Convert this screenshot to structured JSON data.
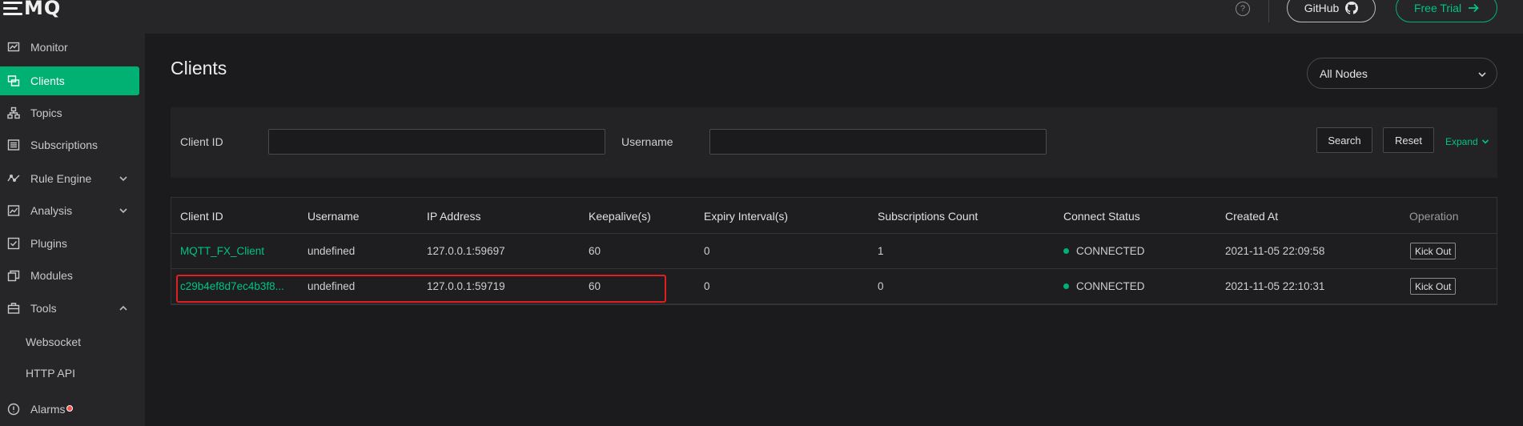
{
  "logo": {
    "text": "MQ"
  },
  "sidebar": {
    "items": [
      {
        "label": "Monitor",
        "icon": "monitor-icon"
      },
      {
        "label": "Clients",
        "icon": "clients-icon",
        "active": true
      },
      {
        "label": "Topics",
        "icon": "topics-icon"
      },
      {
        "label": "Subscriptions",
        "icon": "subscriptions-icon"
      },
      {
        "label": "Rule Engine",
        "icon": "rule-engine-icon",
        "expandable": "collapsed"
      },
      {
        "label": "Analysis",
        "icon": "analysis-icon",
        "expandable": "collapsed"
      },
      {
        "label": "Plugins",
        "icon": "plugins-icon"
      },
      {
        "label": "Modules",
        "icon": "modules-icon"
      },
      {
        "label": "Tools",
        "icon": "tools-icon",
        "expandable": "expanded"
      },
      {
        "label": "Websocket",
        "sub": true
      },
      {
        "label": "HTTP API",
        "sub": true
      },
      {
        "label": "Alarms",
        "icon": "alarm-icon",
        "badge": true
      }
    ]
  },
  "topbar": {
    "help": "?",
    "github_label": "GitHub",
    "trial_label": "Free Trial"
  },
  "page": {
    "title": "Clients",
    "node_select": "All Nodes"
  },
  "search": {
    "client_id_label": "Client ID",
    "username_label": "Username",
    "search_label": "Search",
    "reset_label": "Reset",
    "expand_label": "Expand"
  },
  "table": {
    "columns": [
      "Client ID",
      "Username",
      "IP Address",
      "Keepalive(s)",
      "Expiry Interval(s)",
      "Subscriptions Count",
      "Connect Status",
      "Created At",
      "Operation"
    ],
    "rows": [
      {
        "client_id": "MQTT_FX_Client",
        "username": "undefined",
        "ip": "127.0.0.1:59697",
        "keepalive": "60",
        "expiry": "0",
        "subs": "1",
        "status": "CONNECTED",
        "created": "2021-11-05 22:09:58",
        "action": "Kick Out"
      },
      {
        "client_id": "c29b4ef8d7ec4b3f8...",
        "username": "undefined",
        "ip": "127.0.0.1:59719",
        "keepalive": "60",
        "expiry": "0",
        "subs": "0",
        "status": "CONNECTED",
        "created": "2021-11-05 22:10:31",
        "action": "Kick Out"
      }
    ]
  },
  "colors": {
    "accent": "#00b173",
    "highlight": "#e02020",
    "status_ok": "#00b173"
  }
}
